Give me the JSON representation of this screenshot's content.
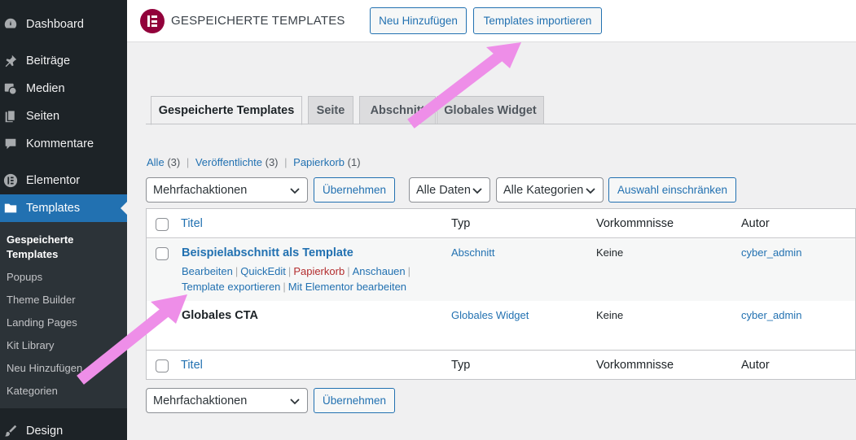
{
  "sidebar": {
    "items": [
      {
        "label": "Dashboard",
        "icon": "dashboard-icon"
      },
      {
        "label": "Beiträge",
        "icon": "pin-icon"
      },
      {
        "label": "Medien",
        "icon": "media-icon"
      },
      {
        "label": "Seiten",
        "icon": "pages-icon"
      },
      {
        "label": "Kommentare",
        "icon": "comment-icon"
      },
      {
        "label": "Elementor",
        "icon": "elementor-icon"
      },
      {
        "label": "Templates",
        "icon": "folder-icon"
      },
      {
        "label": "Design",
        "icon": "brush-icon"
      }
    ],
    "submenu": [
      "Gespeicherte Templates",
      "Popups",
      "Theme Builder",
      "Landing Pages",
      "Kit Library",
      "Neu Hinzufügen",
      "Kategorien"
    ]
  },
  "header": {
    "title": "GESPEICHERTE TEMPLATES",
    "add_new": "Neu Hinzufügen",
    "import": "Templates importieren"
  },
  "tabs": [
    "Gespeicherte Templates",
    "Seite",
    "Abschnitt",
    "Globales Widget"
  ],
  "filters": {
    "all": "Alle",
    "all_count": "(3)",
    "published": "Veröffentlichte",
    "published_count": "(3)",
    "trash": "Papierkorb",
    "trash_count": "(1)",
    "sep": "|"
  },
  "bulk_actions": {
    "placeholder": "Mehrfachaktionen",
    "apply": "Übernehmen",
    "dates": "Alle Daten",
    "categories": "Alle Kategorien",
    "filter": "Auswahl einschränken"
  },
  "table": {
    "columns": [
      "Titel",
      "Typ",
      "Vorkommnisse",
      "Autor"
    ],
    "rows": [
      {
        "title": "Beispielabschnitt als Template",
        "type": "Abschnitt",
        "occurrences": "Keine",
        "author": "cyber_admin",
        "actions": [
          "Bearbeiten",
          "QuickEdit",
          "Papierkorb",
          "Anschauen",
          "Template exportieren",
          "Mit Elementor bearbeiten"
        ]
      },
      {
        "title": "Globales CTA",
        "type": "Globales Widget",
        "occurrences": "Keine",
        "author": "cyber_admin"
      }
    ]
  },
  "colors": {
    "accent": "#2271b1",
    "sidebar": "#1d2327",
    "elementor": "#92003b",
    "arrow": "#ee8ee8"
  }
}
